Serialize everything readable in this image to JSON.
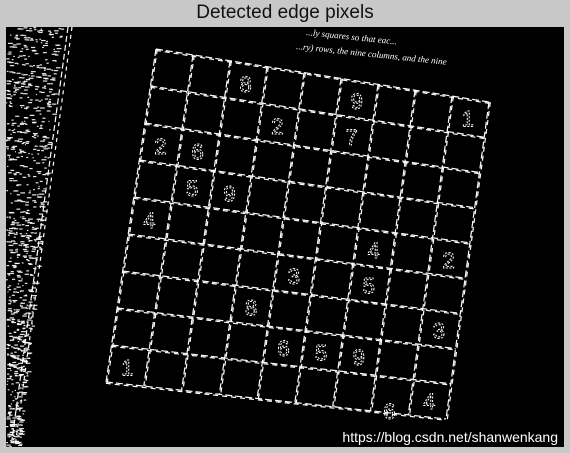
{
  "window": {
    "title": "Detected edge pixels"
  },
  "image": {
    "description_icon": "edge-detected-sudoku-image",
    "background_color": "#000000",
    "edge_color": "#ffffff",
    "grid_size": 9,
    "given_digits": [
      {
        "row": 0,
        "col": 2,
        "value": "8"
      },
      {
        "row": 0,
        "col": 5,
        "value": "9"
      },
      {
        "row": 0,
        "col": 8,
        "value": "1"
      },
      {
        "row": 1,
        "col": 3,
        "value": "2"
      },
      {
        "row": 1,
        "col": 5,
        "value": "7"
      },
      {
        "row": 2,
        "col": 0,
        "value": "2"
      },
      {
        "row": 2,
        "col": 1,
        "value": "6"
      },
      {
        "row": 3,
        "col": 1,
        "value": "5"
      },
      {
        "row": 3,
        "col": 2,
        "value": "9"
      },
      {
        "row": 4,
        "col": 0,
        "value": "4"
      },
      {
        "row": 4,
        "col": 6,
        "value": "4"
      },
      {
        "row": 4,
        "col": 8,
        "value": "2"
      },
      {
        "row": 5,
        "col": 4,
        "value": "3"
      },
      {
        "row": 5,
        "col": 6,
        "value": "5"
      },
      {
        "row": 6,
        "col": 3,
        "value": "8"
      },
      {
        "row": 6,
        "col": 8,
        "value": "3"
      },
      {
        "row": 7,
        "col": 4,
        "value": "6"
      },
      {
        "row": 7,
        "col": 5,
        "value": "5"
      },
      {
        "row": 7,
        "col": 6,
        "value": "9"
      },
      {
        "row": 8,
        "col": 0,
        "value": "1"
      },
      {
        "row": 8,
        "col": 8,
        "value": "4"
      },
      {
        "row": 9,
        "col": 7,
        "value": "6"
      }
    ],
    "text_fragments": [
      "...ly squares so that eac...",
      "...ry) rows, the nine columns, and the nine"
    ]
  },
  "watermark": "https://blog.csdn.net/shanwenkang"
}
